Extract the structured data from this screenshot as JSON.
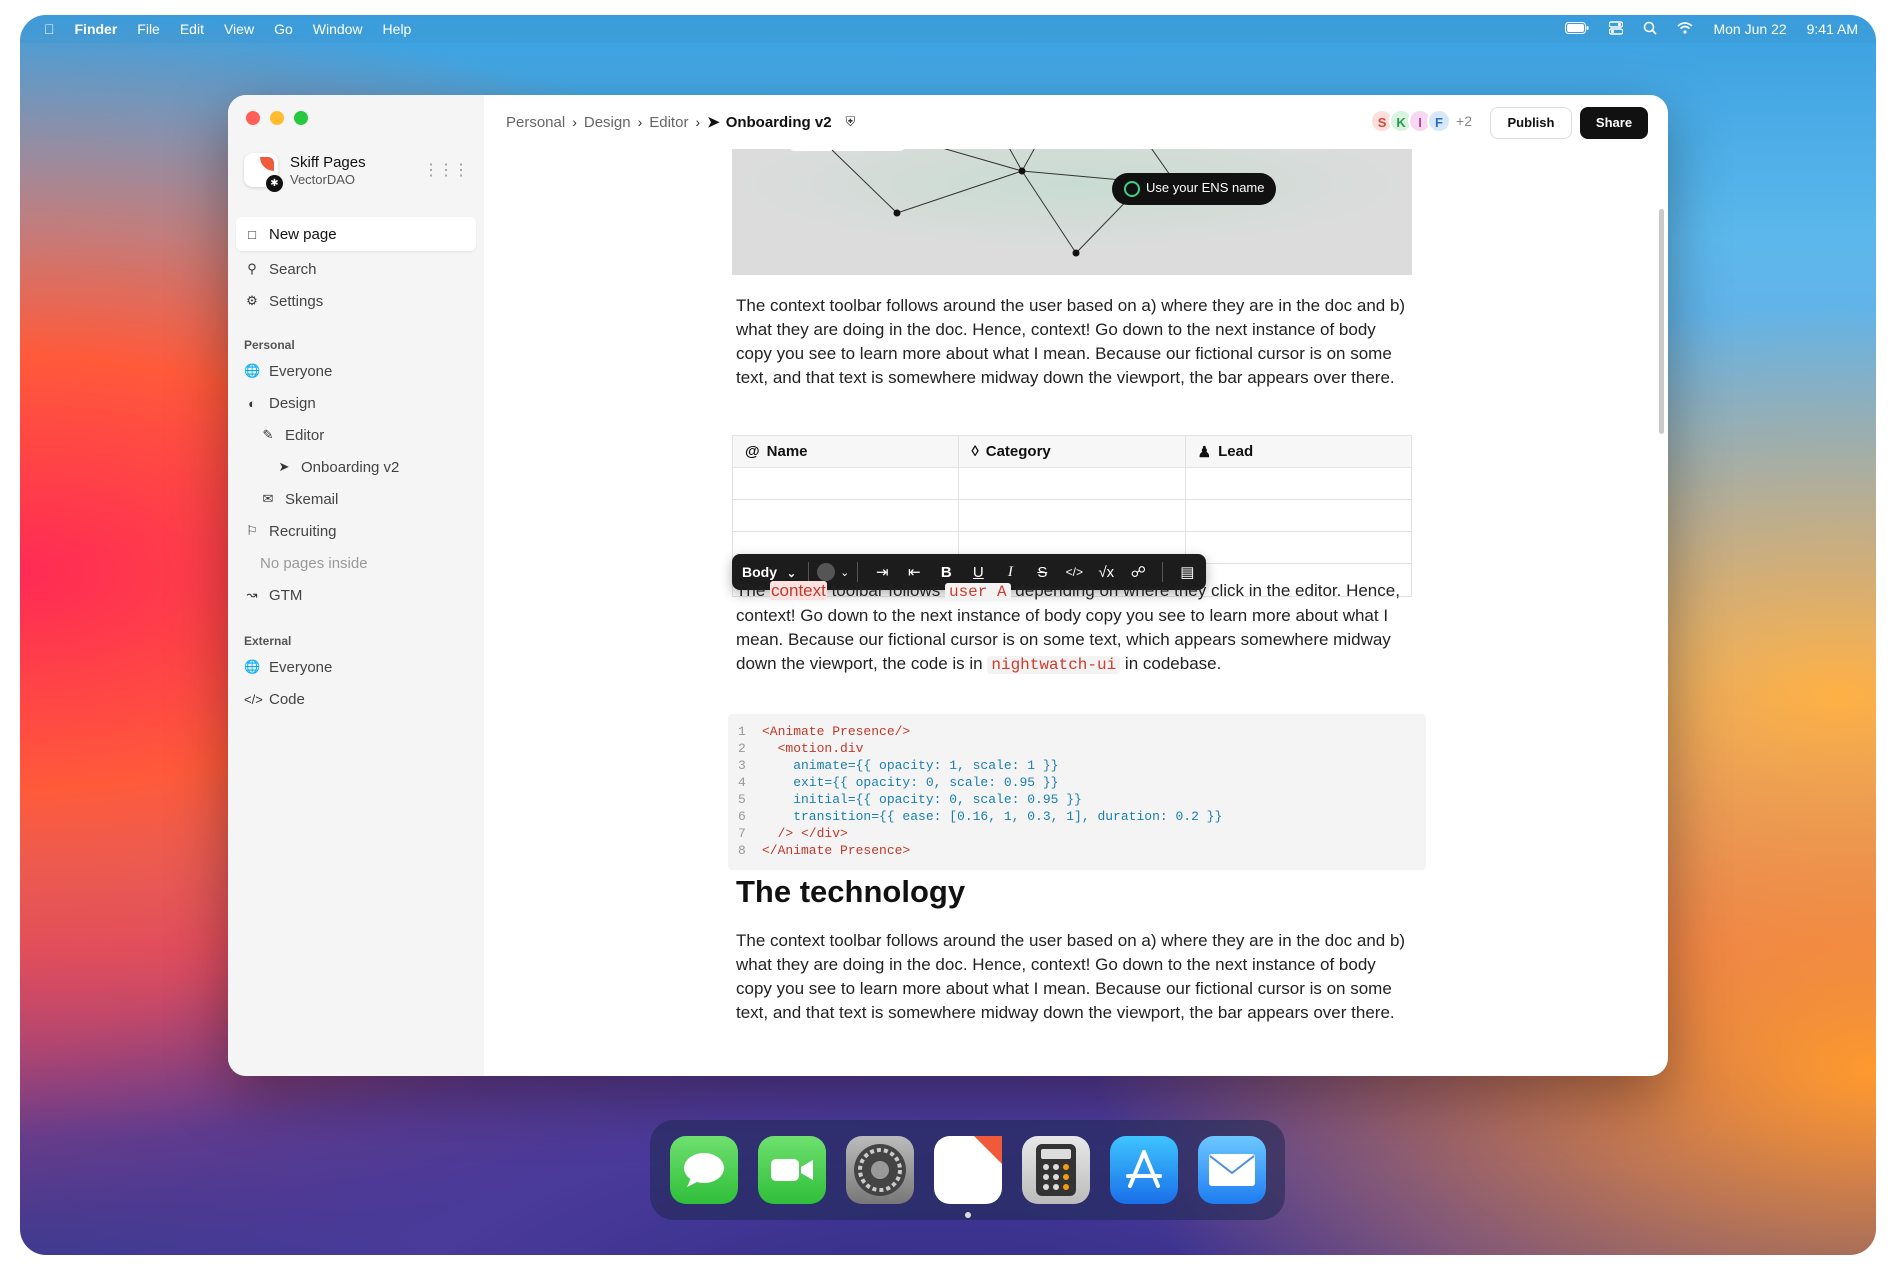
{
  "menubar": {
    "items": [
      "Finder",
      "File",
      "Edit",
      "View",
      "Go",
      "Window",
      "Help"
    ],
    "date": "Mon Jun 22",
    "time": "9:41 AM"
  },
  "workspace": {
    "name": "Skiff Pages",
    "org": "VectorDAO"
  },
  "sidebar": {
    "new_page": "New page",
    "search": "Search",
    "settings": "Settings",
    "personal_label": "Personal",
    "personal": [
      "Everyone",
      "Design",
      "Editor",
      "Onboarding v2",
      "Skemail",
      "Recruiting",
      "No pages inside",
      "GTM"
    ],
    "external_label": "External",
    "external": [
      "Everyone",
      "Code"
    ]
  },
  "breadcrumb": [
    "Personal",
    "Design",
    "Editor",
    "Onboarding v2"
  ],
  "collaborators": [
    "S",
    "K",
    "I",
    "F"
  ],
  "collaborators_more": "+2",
  "actions": {
    "publish": "Publish",
    "share": "Share"
  },
  "hero": {
    "pill": "Use your ENS name"
  },
  "para1": "The context toolbar follows around the user based on a) where they are in the doc and b) what they are doing in the doc. Hence, context! Go down to the next instance of body copy you see to learn more about what I mean. Because our fictional cursor is on some text, and that text is somewhere midway down the viewport, the bar appears over there.",
  "table": {
    "headers": [
      "Name",
      "Category",
      "Lead"
    ]
  },
  "toolbar": {
    "style": "Body"
  },
  "para2": {
    "t1": "The ",
    "hl": "context",
    "t2": " toolbar follows ",
    "code1": "user A",
    "t3": " depending on where they click in the editor. Hence, context! Go down to the next instance of body copy you see to learn more about what I mean. Because our fictional cursor is on some text, which appears somewhere midway down the viewport, the code is in ",
    "code2": "nightwatch-ui",
    "t4": " in codebase."
  },
  "code": [
    {
      "n": "1",
      "text": "<Animate Presence/>"
    },
    {
      "n": "2",
      "text": "  <motion.div"
    },
    {
      "n": "3",
      "text": "    animate={{ opacity: 1, scale: 1 }}"
    },
    {
      "n": "4",
      "text": "    exit={{ opacity: 0, scale: 0.95 }}"
    },
    {
      "n": "5",
      "text": "    initial={{ opacity: 0, scale: 0.95 }}"
    },
    {
      "n": "6",
      "text": "    transition={{ ease: [0.16, 1, 0.3, 1], duration: 0.2 }}"
    },
    {
      "n": "7",
      "text": "  /> </div>"
    },
    {
      "n": "8",
      "text": "</Animate Presence>"
    }
  ],
  "heading": "The technology",
  "para3": "The context toolbar follows around the user based on a) where they are in the doc and b) what they are doing in the doc. Hence, context! Go down to the next instance of body copy you see to learn more about what I mean. Because our fictional cursor is on some text, and that text is somewhere midway down the viewport, the bar appears over there.",
  "dock": [
    "messages-icon",
    "facetime-icon",
    "system-preferences-icon",
    "skiff-pages-icon",
    "calculator-icon",
    "app-store-icon",
    "mail-icon"
  ]
}
